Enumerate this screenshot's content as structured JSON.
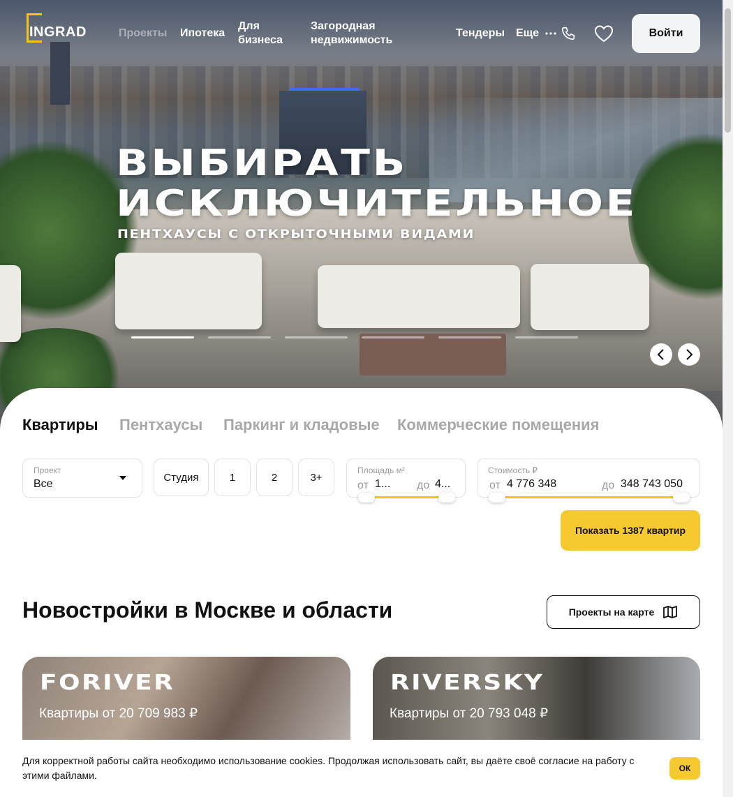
{
  "header": {
    "logo_text": "INGRAD",
    "nav": [
      "Проекты",
      "Ипотека",
      "Для бизнеса",
      "Загородная недвижимость",
      "Тендеры",
      "Еще"
    ],
    "more_icon": "ellipsis-icon",
    "phone_icon": "phone-icon",
    "favorites_icon": "heart-icon",
    "login_label": "Войти"
  },
  "hero": {
    "title_line1": "ВЫБИРАТЬ",
    "title_line2": "ИСКЛЮЧИТЕЛЬНОЕ",
    "subtitle": "ПЕНТХАУСЫ С ОТКРЫТОЧНЫМИ ВИДАМИ",
    "slide_count": 6,
    "active_slide": 1
  },
  "search": {
    "tabs": [
      "Квартиры",
      "Пентхаусы",
      "Паркинг и кладовые",
      "Коммерческие помещения"
    ],
    "active_tab": "Квартиры",
    "project": {
      "label": "Проект",
      "value": "Все"
    },
    "rooms": [
      "Студия",
      "1",
      "2",
      "3+"
    ],
    "area": {
      "label": "Площадь м²",
      "from_prefix": "от",
      "from_value": "1...",
      "to_prefix": "до",
      "to_value": "4..."
    },
    "price": {
      "label": "Стоимость ₽",
      "from_prefix": "от",
      "from_value": "4 776 348",
      "to_prefix": "до",
      "to_value": "348 743 050"
    },
    "submit_label": "Показать 1387 квартир"
  },
  "projects": {
    "title": "Новостройки в Москве и области",
    "map_button": "Проекты на карте",
    "cards": [
      {
        "name": "FORIVER",
        "price": "Квартиры от 20 709 983 ₽"
      },
      {
        "name": "RIVERSKY",
        "price": "Квартиры от 20 793 048 ₽"
      }
    ]
  },
  "cookie": {
    "message": "Для корректной работы сайта необходимо использование cookies. Продолжая использовать сайт, вы даёте своё согласие на работу с этими файлами.",
    "ok_label": "ОК"
  },
  "colors": {
    "accent": "#f7c930",
    "logo_yellow": "#f5c518",
    "text": "#111111",
    "muted": "#a8a8a8"
  }
}
